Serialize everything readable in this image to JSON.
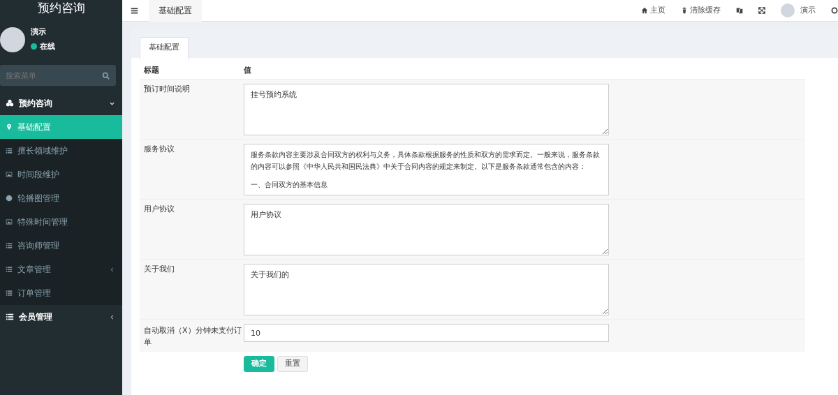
{
  "sidebar": {
    "logo": "预约咨询",
    "user": {
      "name": "演示",
      "status": "在线"
    },
    "search": {
      "placeholder": "搜索菜单"
    },
    "menu": [
      {
        "kind": "group",
        "label": "预约咨询",
        "expanded": true
      },
      {
        "kind": "item",
        "label": "基础配置",
        "selected": true
      },
      {
        "kind": "item",
        "label": "擅长领域维护",
        "selected": false
      },
      {
        "kind": "item",
        "label": "时间段维护",
        "selected": false
      },
      {
        "kind": "item",
        "label": "轮播图管理",
        "selected": false
      },
      {
        "kind": "item",
        "label": "特殊时间管理",
        "selected": false
      },
      {
        "kind": "item",
        "label": "咨询师管理",
        "selected": false
      },
      {
        "kind": "item",
        "label": "文章管理",
        "selected": false,
        "expanded": false
      },
      {
        "kind": "item",
        "label": "订单管理",
        "selected": false
      },
      {
        "kind": "group",
        "label": "会员管理",
        "expanded": false
      }
    ]
  },
  "topbar": {
    "tabs": [
      {
        "label": "基础配置",
        "selected": true
      }
    ],
    "links": [
      {
        "label": "主页"
      },
      {
        "label": "清除缓存"
      }
    ],
    "user": "演示"
  },
  "panel": {
    "tabs": [
      {
        "label": "基础配置",
        "selected": true
      }
    ],
    "columns": [
      "标题",
      "值"
    ],
    "rows": [
      {
        "kind": "textarea",
        "title": "预订时间说明",
        "value": "挂号预约系统"
      },
      {
        "kind": "textarea",
        "title": "服务协议",
        "paragraphs": [
          "服务条款内容主要涉及合同双方的权利与义务，具体条款根据服务的性质和双方的需求而定。一般来说，服务条款的内容可以参照《中华人民共和国民法典》中关于合同内容的规定来制定。以下是服务条款通常包含的内容：",
          "一、合同双方的基本信息"
        ]
      },
      {
        "kind": "textarea",
        "title": "用户协议",
        "value": "用户协议"
      },
      {
        "kind": "textarea",
        "title": "关于我们",
        "value": "关于我们的"
      },
      {
        "kind": "input",
        "title": "自动取消（X）分钟未支付订单",
        "value": "10"
      }
    ],
    "buttons": [
      {
        "kind": "primary",
        "label": "确定"
      },
      {
        "kind": "default",
        "label": "重置"
      }
    ]
  }
}
